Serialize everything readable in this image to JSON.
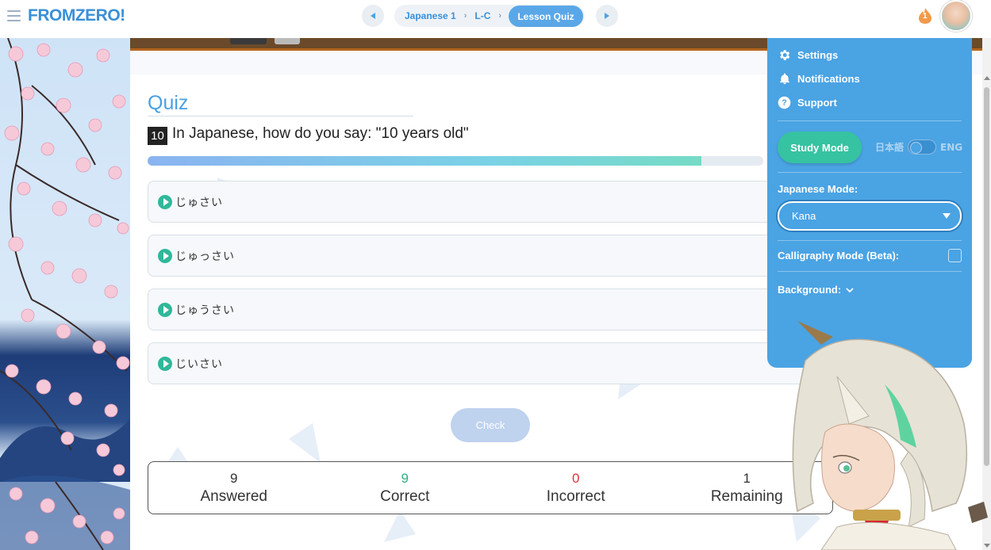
{
  "header": {
    "logo": "FROMZERO!",
    "breadcrumb": [
      "Japanese 1",
      "L-C"
    ],
    "current": "Lesson Quiz",
    "prev_icon": "triangle-left-icon",
    "next_icon": "triangle-right-icon",
    "streak_icon": "flame-icon",
    "streak_count": "1"
  },
  "quiz": {
    "title": "Quiz",
    "question_number": "10",
    "question": "In Japanese, how do you say: \"10 years old\"",
    "progress_fraction": 0.9,
    "options": [
      "じゅさい",
      "じゅっさい",
      "じゅうさい",
      "じいさい"
    ],
    "check_label": "Check"
  },
  "stats": [
    {
      "value": "9",
      "label": "Answered",
      "color": "#333333"
    },
    {
      "value": "9",
      "label": "Correct",
      "color": "#2fae7f"
    },
    {
      "value": "0",
      "label": "Incorrect",
      "color": "#e0333a"
    },
    {
      "value": "1",
      "label": "Remaining",
      "color": "#333333"
    }
  ],
  "settings_menu": {
    "items": [
      {
        "label": "Settings",
        "icon": "gear-icon"
      },
      {
        "label": "Notifications",
        "icon": "bell-icon"
      },
      {
        "label": "Support",
        "icon": "question-icon"
      }
    ],
    "study_mode_label": "Study Mode",
    "lang_left": "日本語",
    "lang_right": "ENG",
    "japanese_mode_label": "Japanese Mode:",
    "japanese_mode_value": "Kana",
    "calligraphy_label": "Calligraphy Mode (Beta):",
    "background_label": "Background:"
  },
  "colors": {
    "brand_blue": "#4aa3e3",
    "accent_green": "#36c3a1",
    "correct_green": "#2fae7f",
    "incorrect_red": "#e0333a"
  }
}
